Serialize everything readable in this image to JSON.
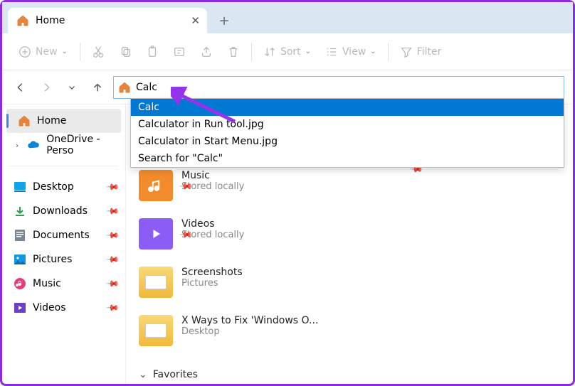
{
  "tab": {
    "title": "Home"
  },
  "toolbar": {
    "new": "New",
    "sort": "Sort",
    "view": "View",
    "filter": "Filter"
  },
  "address": {
    "value": "Calc",
    "suggestions": [
      "Calc",
      "Calculator in Run tool.jpg",
      "Calculator in Start Menu.jpg",
      "Search for \"Calc\""
    ]
  },
  "sidebar": {
    "home": "Home",
    "onedrive": "OneDrive - Perso",
    "quick": [
      {
        "label": "Desktop"
      },
      {
        "label": "Downloads"
      },
      {
        "label": "Documents"
      },
      {
        "label": "Pictures"
      },
      {
        "label": "Music"
      },
      {
        "label": "Videos"
      }
    ]
  },
  "content": {
    "items": [
      {
        "name": "Music",
        "sub": "Stored locally",
        "color": "#f28b2c",
        "glyph": "music"
      },
      {
        "name": "Videos",
        "sub": "Stored locally",
        "color": "#8b5cf6",
        "glyph": "video"
      },
      {
        "name": "Screenshots",
        "sub": "Pictures",
        "color": "#f9c84b",
        "glyph": "folder"
      },
      {
        "name": "X Ways to Fix 'Windows O...",
        "sub": "Desktop",
        "color": "#f9c84b",
        "glyph": "folder"
      }
    ],
    "favorites": "Favorites"
  }
}
